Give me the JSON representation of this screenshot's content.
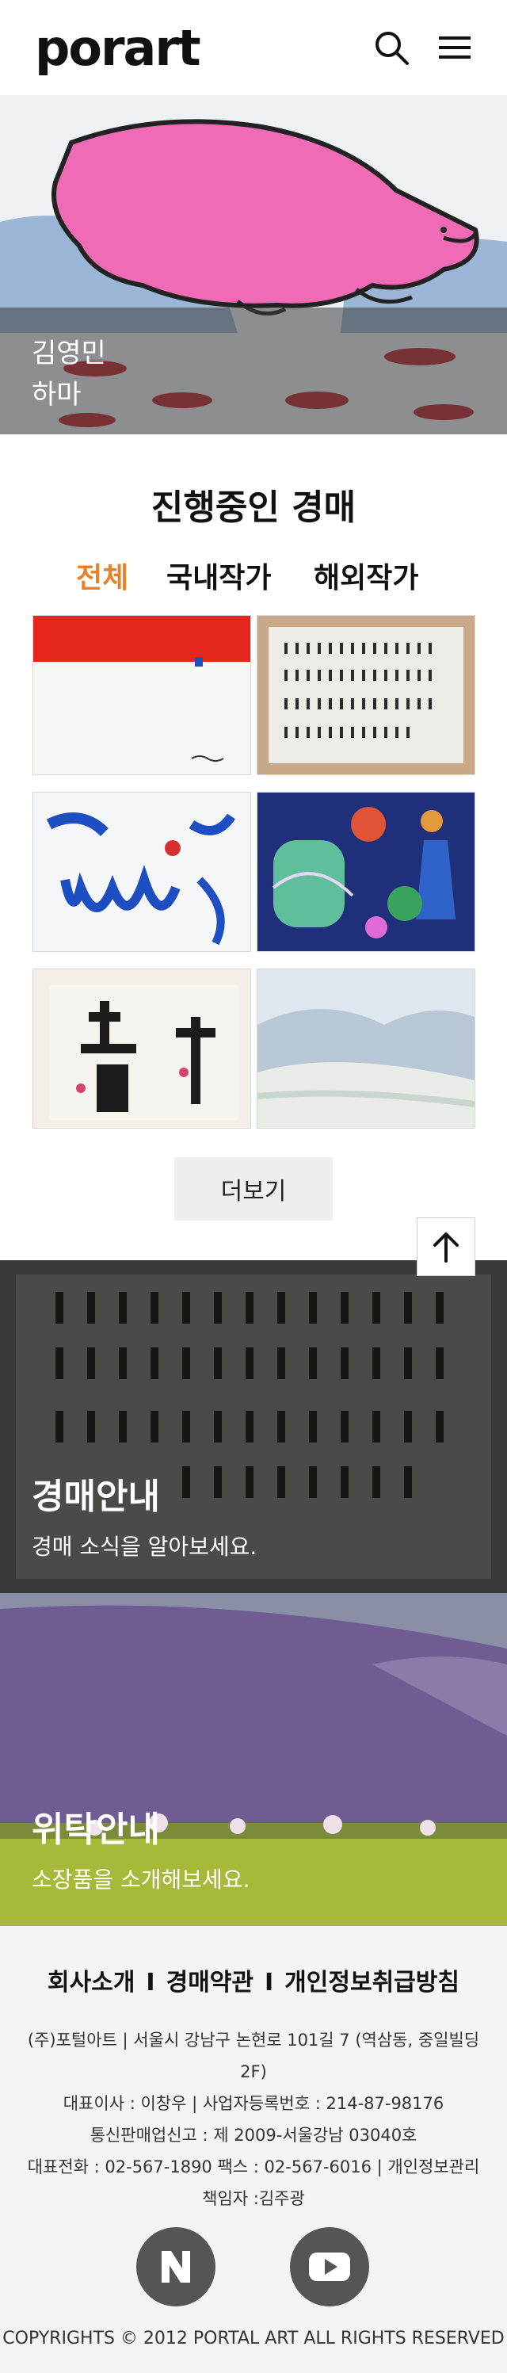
{
  "header": {
    "logo": "porart"
  },
  "hero": {
    "artist": "김영민",
    "title": "하마"
  },
  "auction": {
    "title": "진행중인 경매",
    "tabs": [
      {
        "label": "전체",
        "active": true
      },
      {
        "label": "국내작가",
        "active": false
      },
      {
        "label": "해외작가",
        "active": false
      }
    ],
    "more_label": "더보기"
  },
  "banners": [
    {
      "title": "경매안내",
      "subtitle": "경매 소식을 알아보세요."
    },
    {
      "title": "위탁안내",
      "subtitle": "소장품을 소개해보세요."
    }
  ],
  "footer": {
    "links": [
      "회사소개",
      "경매약관",
      "개인정보취급방침"
    ],
    "separator": "I",
    "info": [
      "(주)포털아트 | 서울시 강남구 논현로 101길 7 (역삼동, 중일빌딩 2F)",
      "대표이사 : 이창우 | 사업자등록번호 : 214-87-98176",
      "통신판매업신고 : 제 2009-서울강남 03040호",
      "대표전화 : 02-567-1890 팩스 : 02-567-6016 | 개인정보관리책임자 :김주광"
    ],
    "copyright": "COPYRIGHTS © 2012 PORTAL ART ALL RIGHTS RESERVED"
  },
  "colors": {
    "accent": "#e8812a",
    "text": "#111111",
    "footer_bg": "#f4f4f4",
    "sns_bg": "#555555"
  },
  "icons": [
    "search-icon",
    "hamburger-menu-icon",
    "arrow-up-icon",
    "naver-blog-icon",
    "youtube-icon"
  ]
}
